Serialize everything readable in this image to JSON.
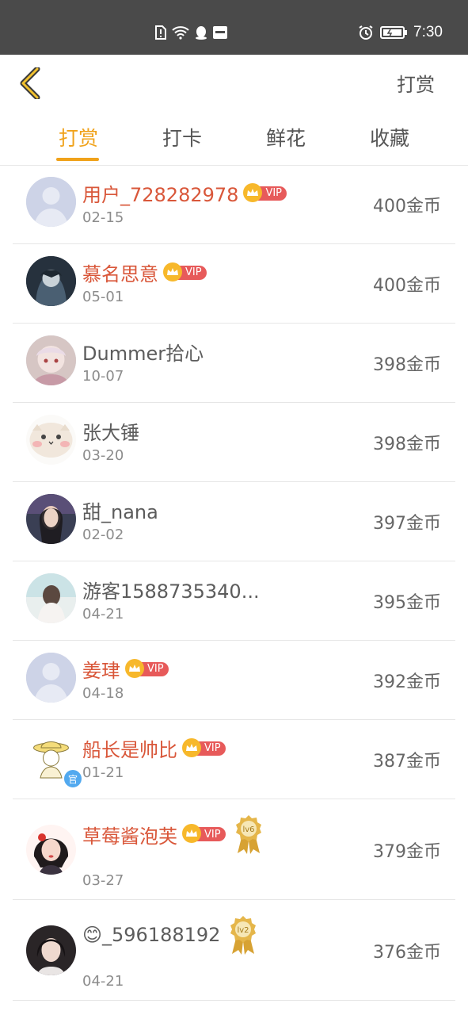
{
  "status_bar": {
    "time": "7:30"
  },
  "header": {
    "title": "打赏"
  },
  "tabs": [
    {
      "label": "打赏",
      "active": true
    },
    {
      "label": "打卡",
      "active": false
    },
    {
      "label": "鲜花",
      "active": false
    },
    {
      "label": "收藏",
      "active": false
    }
  ],
  "rows": [
    {
      "name": "用户_728282978",
      "vip": true,
      "date": "02-15",
      "coins": "400金币",
      "avatar": "default-avatar"
    },
    {
      "name": "慕名思意",
      "vip": true,
      "date": "05-01",
      "coins": "400金币",
      "avatar": "anime-avatar"
    },
    {
      "name": "Dummer拾心",
      "vip": false,
      "date": "10-07",
      "coins": "398金币",
      "avatar": "doll-avatar"
    },
    {
      "name": "张大锤",
      "vip": false,
      "date": "03-20",
      "coins": "398金币",
      "avatar": "hamster-avatar"
    },
    {
      "name": "甜_nana",
      "vip": false,
      "date": "02-02",
      "coins": "397金币",
      "avatar": "photo-avatar"
    },
    {
      "name": "游客1588735340...",
      "vip": false,
      "date": "04-21",
      "coins": "395金币",
      "avatar": "photo-avatar"
    },
    {
      "name": "姜珒",
      "vip": true,
      "date": "04-18",
      "coins": "392金币",
      "avatar": "default-avatar"
    },
    {
      "name": "船长是帅比",
      "vip": true,
      "date": "01-21",
      "coins": "387金币",
      "avatar": "straw-hat-avatar",
      "official": "官"
    },
    {
      "name": "草莓酱泡芙",
      "vip": true,
      "date": "03-27",
      "coins": "379金币",
      "avatar": "girl-avatar",
      "medal": "lv6"
    },
    {
      "name": "😊_596188192",
      "vip": false,
      "date": "04-21",
      "coins": "376金币",
      "avatar": "photo-avatar",
      "medal": "lv2"
    }
  ],
  "vip_label": "VIP",
  "colors": {
    "accent": "#f0a21a",
    "vip_name": "#d9573a",
    "vip_badge": "#e75a5a"
  }
}
